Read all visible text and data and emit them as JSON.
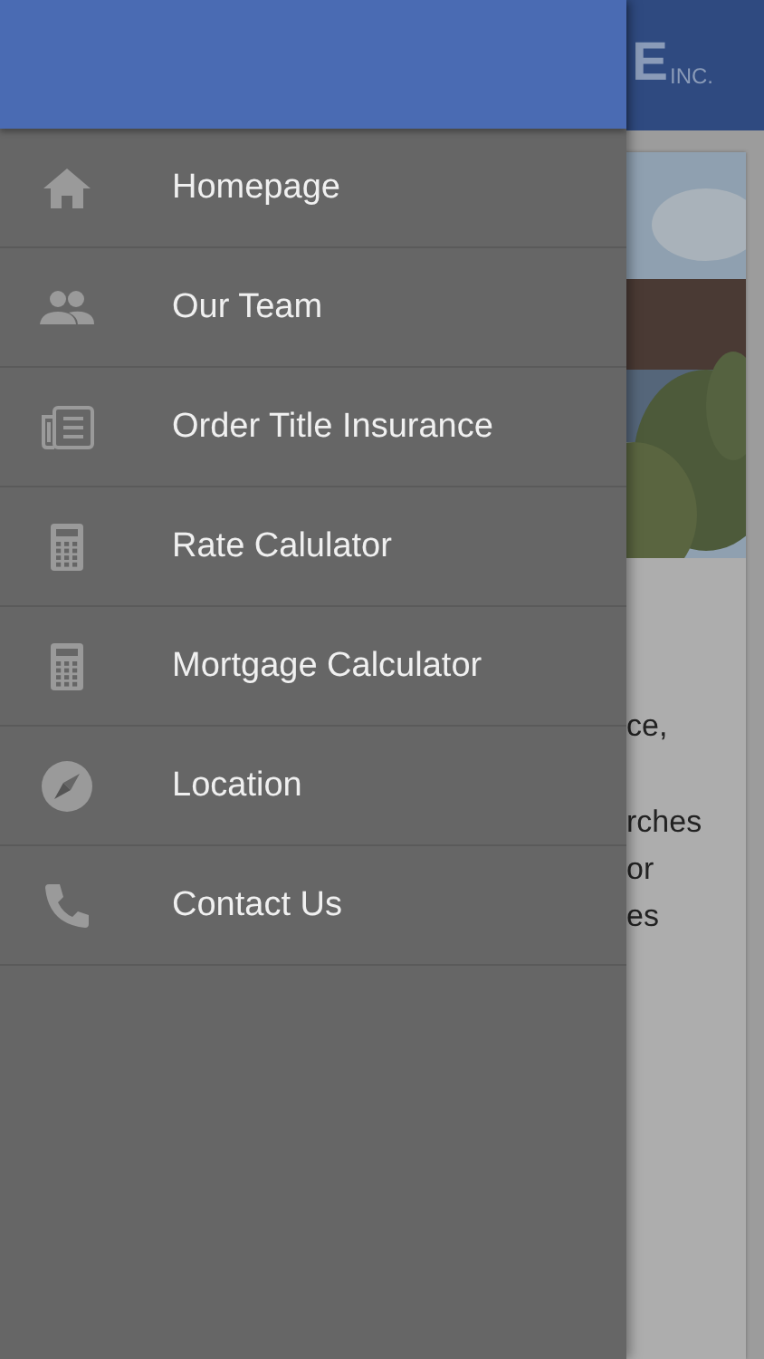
{
  "background_page": {
    "header": {
      "logo_fragment": "E",
      "logo_suffix": "INC."
    },
    "text_fragments": [
      "ce,",
      "rches",
      "or",
      "es"
    ]
  },
  "drawer": {
    "items": [
      {
        "label": "Homepage",
        "kind": "home"
      },
      {
        "label": "Our Team",
        "kind": "people"
      },
      {
        "label": "Order Title Insurance",
        "kind": "newspaper"
      },
      {
        "label": "Rate Calulator",
        "kind": "calculator"
      },
      {
        "label": "Mortgage Calculator",
        "kind": "calculator"
      },
      {
        "label": "Location",
        "kind": "compass"
      },
      {
        "label": "Contact Us",
        "kind": "phone"
      }
    ]
  }
}
